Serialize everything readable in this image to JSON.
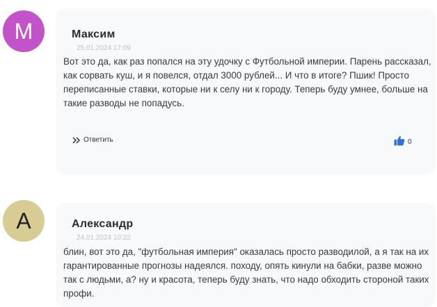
{
  "comments": [
    {
      "initial": "M",
      "author": "Максим",
      "date": "25.01.2024 17:09",
      "text": "Вот это да, как раз попался на эту удочку с Футбольной империи. Парень рассказал, как сорвать куш, и я повелся, отдал 3000 рублей... И что в итоге? Пшик! Просто переписанные ставки, которые ни к селу ни к городу. Теперь буду умнее, больше на такие разводы не попадусь.",
      "reply_label": "Ответить",
      "likes": "0"
    },
    {
      "initial": "A",
      "author": "Александр",
      "date": "24.01.2024 10:22",
      "text": "блин, вот это да, \"футбольная империя\" оказалась просто разводилой, а я так на их гарантированные прогнозы надеялся. походу, опять кинули на бабки, разве можно так с людьми, а? ну и красота, теперь буду знать, что надо обходить стороной таких профи."
    }
  ],
  "colors": {
    "avatar_1": "#c253c9",
    "avatar_2": "#d7cc93",
    "like_icon": "#2f6fdf"
  },
  "icons": {
    "reply": "double-chevron-right-icon",
    "like": "thumbs-up-icon"
  }
}
